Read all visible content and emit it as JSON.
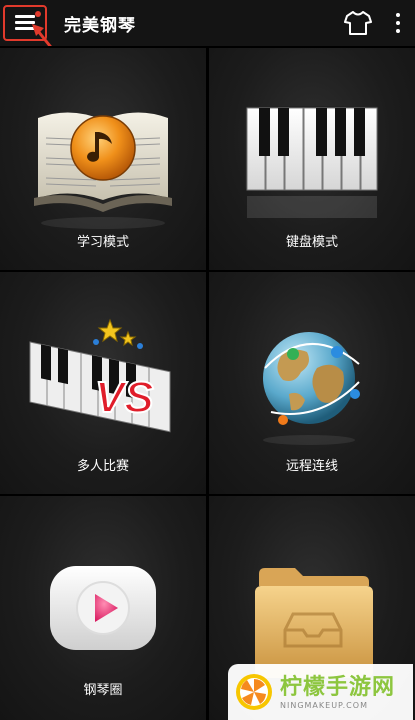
{
  "appbar": {
    "title": "完美钢琴",
    "menu_icon": "menu-icon",
    "shirt_icon": "tshirt-icon",
    "more_icon": "more-vertical-icon",
    "highlight_color": "#e23a2c"
  },
  "tiles": [
    {
      "label": "学习模式",
      "icon": "music-book-icon"
    },
    {
      "label": "键盘模式",
      "icon": "piano-keys-icon"
    },
    {
      "label": "多人比赛",
      "icon": "piano-vs-icon"
    },
    {
      "label": "远程连线",
      "icon": "globe-network-icon"
    },
    {
      "label": "钢琴圈",
      "icon": "play-circle-icon"
    },
    {
      "label": "",
      "icon": "folder-icon"
    }
  ],
  "watermark": {
    "name": "柠檬手游网",
    "url": "NINGMAKEUP.COM",
    "color": "#8dc63f"
  }
}
